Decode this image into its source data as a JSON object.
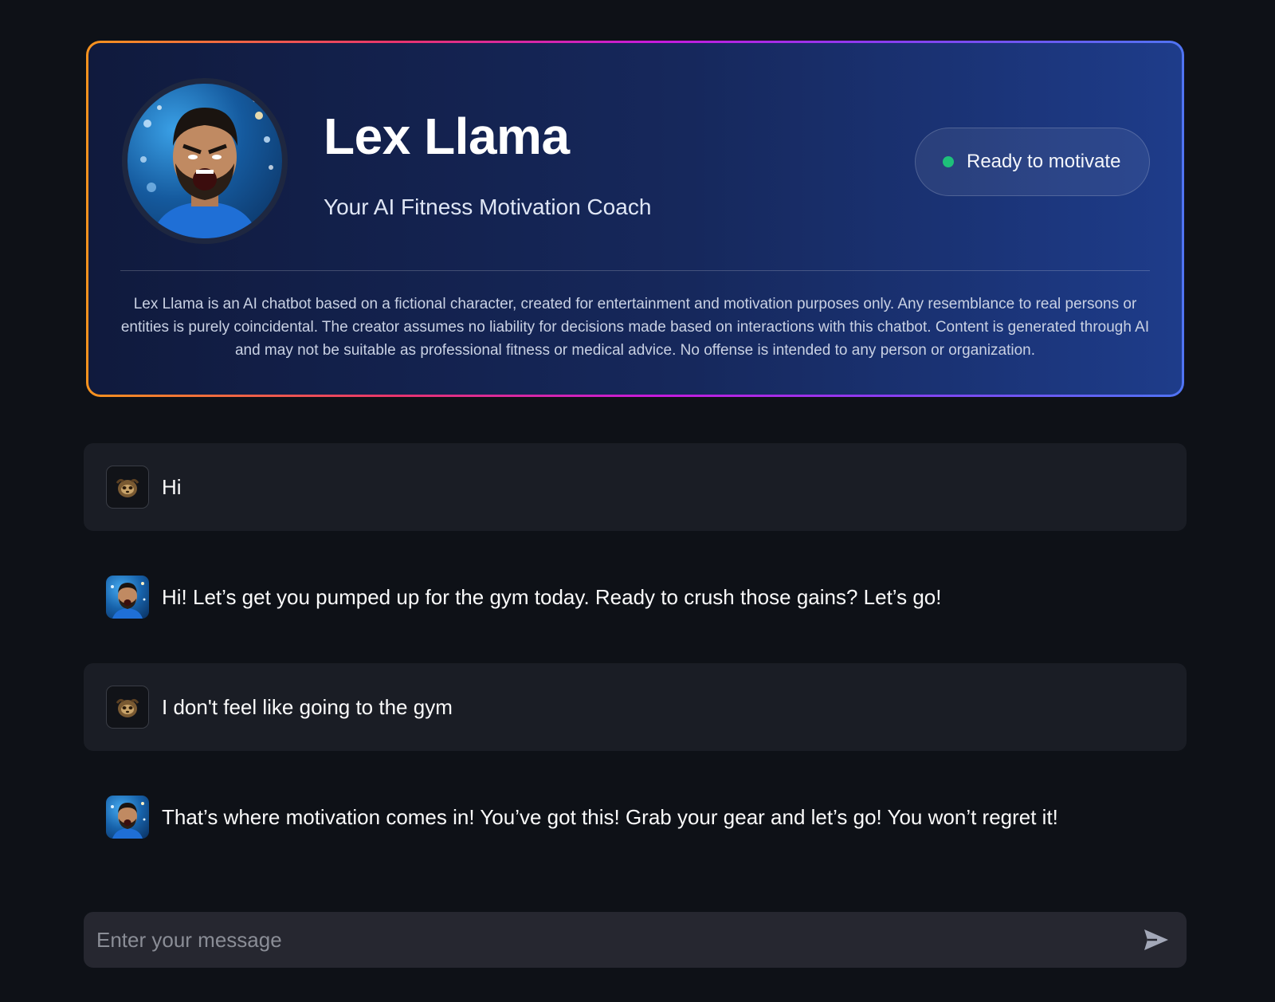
{
  "header": {
    "title": "Lex Llama",
    "subtitle": "Your AI Fitness Motivation Coach",
    "status_label": "Ready to motivate",
    "status_color": "#1ec07a",
    "disclaimer": "Lex Llama is an AI chatbot based on a fictional character, created for entertainment and motivation purposes only. Any resemblance to real persons or entities is purely coincidental. The creator assumes no liability for decisions made based on interactions with this chatbot. Content is generated through AI and may not be suitable as professional fitness or medical advice. No offense is intended to any person or organization."
  },
  "messages": [
    {
      "role": "user",
      "avatar_icon": "sloth-avatar-icon",
      "text": "Hi"
    },
    {
      "role": "assistant",
      "avatar_icon": "coach-avatar-icon",
      "text": "Hi! Let’s get you pumped up for the gym today. Ready to crush those gains? Let’s go!"
    },
    {
      "role": "user",
      "avatar_icon": "sloth-avatar-icon",
      "text": "I don't feel like going to the gym"
    },
    {
      "role": "assistant",
      "avatar_icon": "coach-avatar-icon",
      "text": "That’s where motivation comes in! You’ve got this! Grab your gear and let’s go! You won’t regret it!"
    }
  ],
  "input": {
    "placeholder": "Enter your message",
    "value": "",
    "send_icon": "send-icon"
  },
  "colors": {
    "background": "#0e1117",
    "user_bubble": "#1a1d25",
    "input_bg": "#262730",
    "border_gradient": [
      "#f7931e",
      "#e8356d",
      "#c51bdc",
      "#4f74f3"
    ]
  }
}
